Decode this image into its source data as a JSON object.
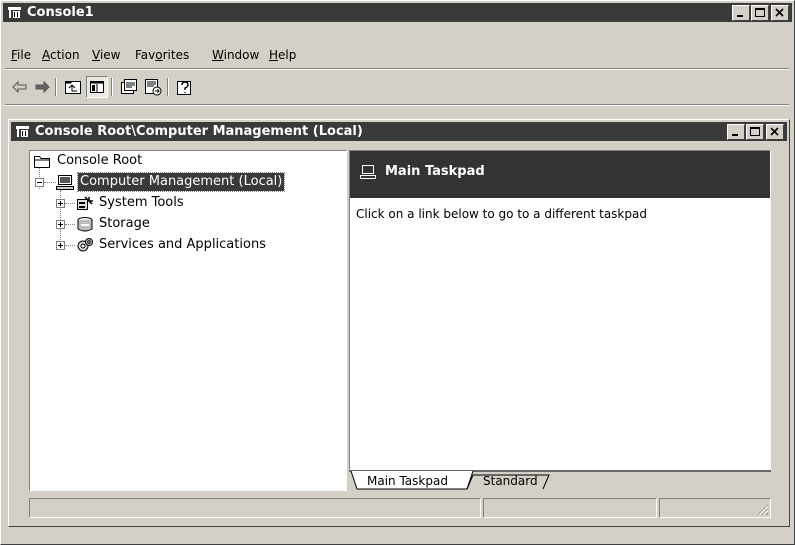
{
  "app": {
    "title": "Console1"
  },
  "menu": [
    {
      "label": "File",
      "accel": "F",
      "rest": "ile"
    },
    {
      "label": "Action",
      "accel": "A",
      "rest": "ction"
    },
    {
      "label": "View",
      "accel": "V",
      "rest": "iew"
    },
    {
      "label": "Favorites",
      "pre": "Fav",
      "accel": "o",
      "rest": "rites"
    },
    {
      "label": "Window",
      "accel": "W",
      "rest": "indow"
    },
    {
      "label": "Help",
      "accel": "H",
      "rest": "elp"
    }
  ],
  "toolbar": {
    "buttons": [
      "back-icon",
      "forward-icon",
      "up-one-level-icon",
      "show-hide-console-tree-icon",
      "properties-icon",
      "export-list-icon",
      "help-icon"
    ]
  },
  "inner_window": {
    "title": "Console Root\\Computer Management (Local)"
  },
  "tree": {
    "root": "Console Root",
    "computer": "Computer Management (Local)",
    "children": [
      "System Tools",
      "Storage",
      "Services and Applications"
    ]
  },
  "taskpad": {
    "title": "Main Taskpad",
    "description": "Click on a link below to go to a different taskpad"
  },
  "tabs": [
    "Main Taskpad",
    "Standard"
  ],
  "colors": {
    "face": "#d4d0c8",
    "titlebar": "#3a3a3a",
    "header": "#333333"
  }
}
